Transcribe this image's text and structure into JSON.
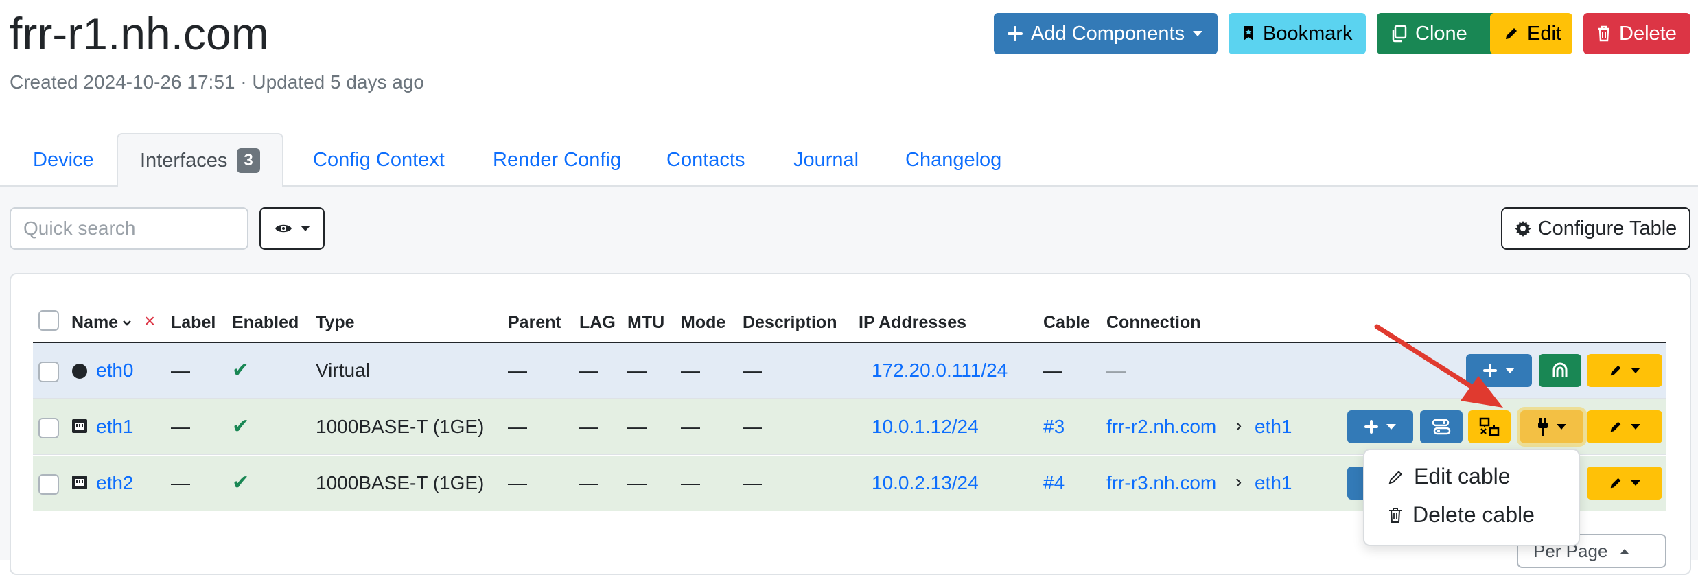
{
  "header": {
    "title": "frr-r1.nh.com",
    "meta": "Created 2024-10-26 17:51 · Updated 5 days ago",
    "buttons": {
      "add_components": "Add Components",
      "bookmark": "Bookmark",
      "clone": "Clone",
      "edit": "Edit",
      "delete": "Delete"
    }
  },
  "tabs": [
    {
      "label": "Device"
    },
    {
      "label": "Interfaces",
      "badge": "3",
      "active": true
    },
    {
      "label": "Config Context"
    },
    {
      "label": "Render Config"
    },
    {
      "label": "Contacts"
    },
    {
      "label": "Journal"
    },
    {
      "label": "Changelog"
    }
  ],
  "toolbar": {
    "search_placeholder": "Quick search",
    "configure_table": "Configure Table"
  },
  "table": {
    "columns": [
      "Name",
      "Label",
      "Enabled",
      "Type",
      "Parent",
      "LAG",
      "MTU",
      "Mode",
      "Description",
      "IP Addresses",
      "Cable",
      "Connection"
    ],
    "clear_sort": "×",
    "rows": [
      {
        "name": "eth0",
        "label": "—",
        "type": "Virtual",
        "parent": "—",
        "lag": "—",
        "mtu": "—",
        "mode": "—",
        "description": "—",
        "ip": "172.20.0.111/24",
        "cable": "—",
        "connection": "—"
      },
      {
        "name": "eth1",
        "label": "—",
        "type": "1000BASE-T (1GE)",
        "parent": "—",
        "lag": "—",
        "mtu": "—",
        "mode": "—",
        "description": "—",
        "ip": "10.0.1.12/24",
        "cable": "#3",
        "peer_device": "frr-r2.nh.com",
        "peer_interface": "eth1"
      },
      {
        "name": "eth2",
        "label": "—",
        "type": "1000BASE-T (1GE)",
        "parent": "—",
        "lag": "—",
        "mtu": "—",
        "mode": "—",
        "description": "—",
        "ip": "10.0.2.13/24",
        "cable": "#4",
        "peer_device": "frr-r3.nh.com",
        "peer_interface": "eth1"
      }
    ],
    "enabled_mark": "✔",
    "separator": "›"
  },
  "dropdown": {
    "edit_cable": "Edit cable",
    "delete_cable": "Delete cable"
  },
  "per_page": "Per Page",
  "colors": {
    "primary": "#337ab7",
    "info": "#5bd3f0",
    "success": "#198754",
    "warning": "#ffc107",
    "danger": "#dc3545",
    "link": "#0d6efd",
    "annotation_arrow": "#e03a2f"
  },
  "icons": [
    "plus-icon",
    "bookmark-icon",
    "clone-icon",
    "pencil-icon",
    "trash-icon",
    "eye-icon",
    "gear-icon",
    "virtual-dot-icon",
    "ethernet-port-icon",
    "trace-icon",
    "disconnect-icon",
    "connector-icon",
    "circuit-icon",
    "sort-chevron-icon"
  ]
}
